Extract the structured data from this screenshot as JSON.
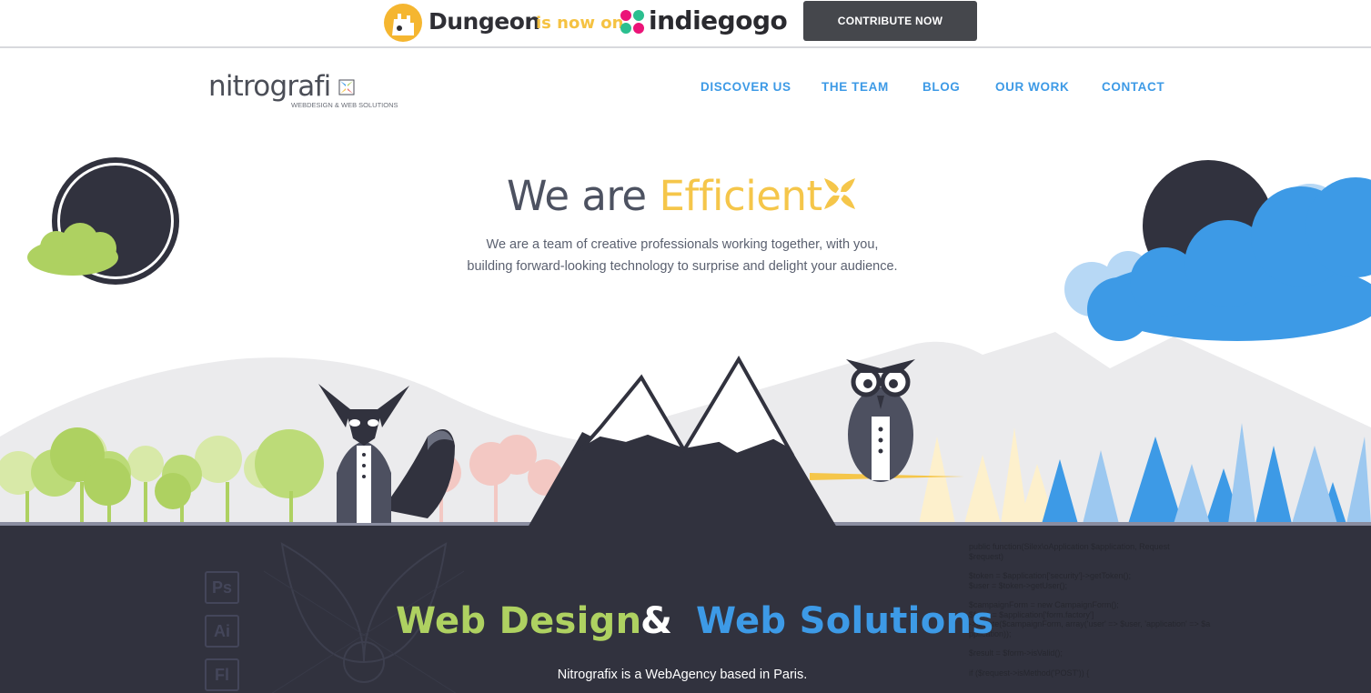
{
  "promo": {
    "logo_icon": "dungeon-logo-icon",
    "brand": "Dungeon",
    "middle": "is now on",
    "platform_icon": "indiegogo-logo-icon",
    "platform": "indiegogo",
    "button": "CONTRIBUTE NOW"
  },
  "header": {
    "logo_text": "nitrografi",
    "logo_mark": "nitrografix-mark-icon",
    "logo_tagline": "WEBDESIGN & WEB SOLUTIONS",
    "nav": [
      "DISCOVER US",
      "THE TEAM",
      "BLOG",
      "OUR WORK",
      "CONTACT"
    ]
  },
  "hero": {
    "title_start": "We are",
    "title_accent": "Efficient",
    "title_icon": "lightning-flower-icon",
    "subtitle_line1": "We are a team of creative professionals working together, with you,",
    "subtitle_line2": "building forward-looking technology to surprise and delight your audience."
  },
  "services": {
    "web_design": "Web Design",
    "ampersand": "&",
    "web_solutions": "Web Solutions",
    "tagline": "Nitrografix is a WebAgency based in Paris.",
    "tool_icons": [
      "Ps",
      "Ai",
      "Fl"
    ],
    "code_lines": [
      "public function(Silex\\oApplication $application, Request",
      "$request)",
      "",
      "$token = $application['security']->getToken();",
      "$user = $token->getUser();",
      "",
      "$campaignForm = new CampaignForm();",
      "$form = $application['form.factory']",
      "->create($campaignForm, array('user' => $user, 'application' => $a",
      "pplication));",
      "",
      "$result = $form->isValid();",
      "",
      "if ($request->isMethod('POST')) {"
    ]
  },
  "colors": {
    "blue": "#3d9ae6",
    "yellow": "#f5c64a",
    "green": "#aed161",
    "dark": "#31323e"
  }
}
